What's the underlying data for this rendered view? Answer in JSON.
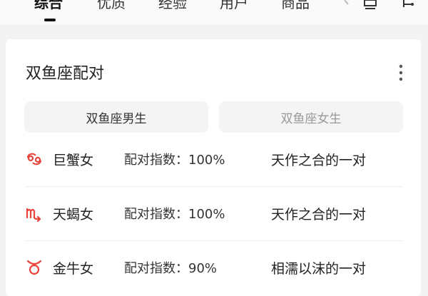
{
  "topbar": {
    "tabs": [
      {
        "label": "综合"
      },
      {
        "label": "优质"
      },
      {
        "label": "经验"
      },
      {
        "label": "用户"
      },
      {
        "label": "商品"
      }
    ]
  },
  "card": {
    "title": "双鱼座配对",
    "segments": {
      "male": "双鱼座男生",
      "female": "双鱼座女生"
    },
    "rows": [
      {
        "symbol": "cancer-icon",
        "name": "巨蟹女",
        "score": "配对指数：100%",
        "desc": "天作之合的一对"
      },
      {
        "symbol": "scorpio-icon",
        "name": "天蝎女",
        "score": "配对指数：100%",
        "desc": "天作之合的一对"
      },
      {
        "symbol": "taurus-icon",
        "name": "金牛女",
        "score": "配对指数：90%",
        "desc": "相濡以沫的一对"
      }
    ]
  },
  "colors": {
    "accent": "#e8433a",
    "background": "#f3f3f3",
    "card": "#ffffff"
  }
}
